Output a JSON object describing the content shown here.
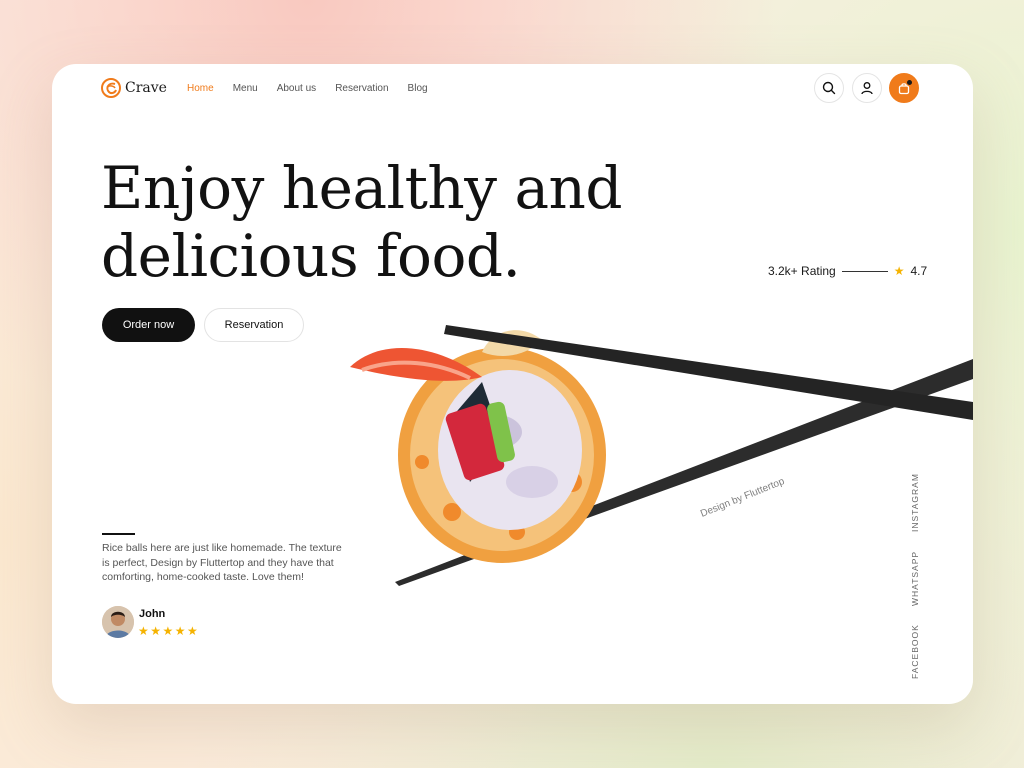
{
  "brand": {
    "name": "Crave",
    "accent": "#f07b1b",
    "logo_icon": "crave-swirl-icon"
  },
  "nav": {
    "items": [
      {
        "label": "Home",
        "active": true
      },
      {
        "label": "Menu",
        "active": false
      },
      {
        "label": "About us",
        "active": false
      },
      {
        "label": "Reservation",
        "active": false
      },
      {
        "label": "Blog",
        "active": false
      }
    ]
  },
  "header_actions": {
    "search_icon": "search-icon",
    "user_icon": "user-icon",
    "cart_icon": "shopping-bag-icon"
  },
  "hero": {
    "title_line1": "Enjoy healthy and",
    "title_line2": "delicious food.",
    "primary_cta": "Order now",
    "secondary_cta": "Reservation",
    "rating_text": "3.2k+ Rating",
    "rating_value": "4.7",
    "watermark": "Design by Fluttertop"
  },
  "testimonial": {
    "text": "Rice balls here are just like homemade. The texture is perfect, Design by Fluttertop and they have that comforting, home-cooked taste. Love them!",
    "name": "John",
    "stars": 5,
    "stars_display": "★★★★★"
  },
  "social": [
    "INSTAGRAM",
    "WHATSAPP",
    "FACEBOOK"
  ]
}
